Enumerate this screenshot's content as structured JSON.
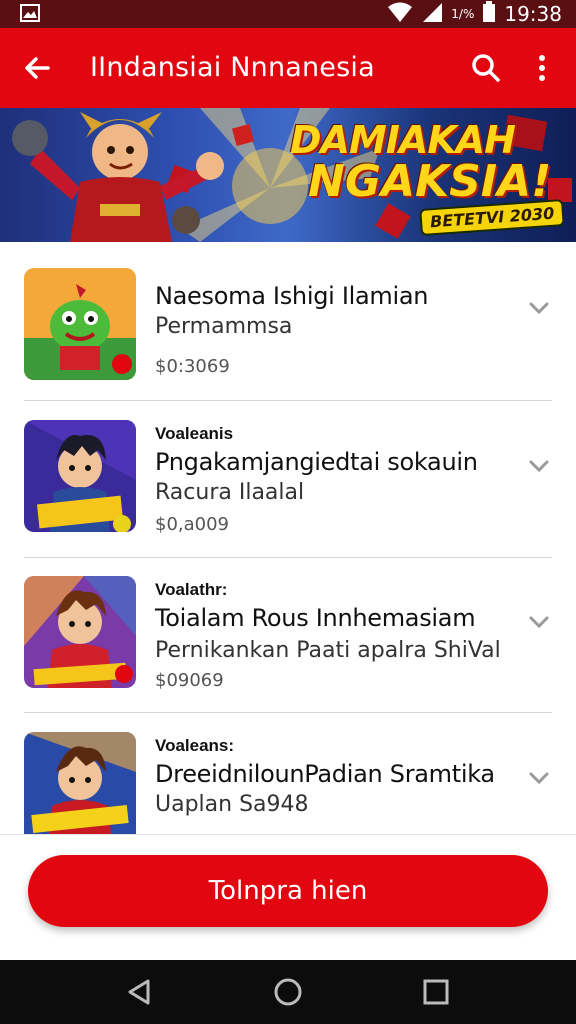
{
  "status_bar": {
    "time": "19:38",
    "battery_text": "1/%",
    "icons": [
      "image-icon",
      "wifi-icon",
      "signal-icon",
      "battery-icon"
    ]
  },
  "app_bar": {
    "title": "IIndansiai Nnnanesia",
    "icons": [
      "back-arrow-icon",
      "search-icon",
      "more-vert-icon"
    ],
    "color": "#e1060f"
  },
  "banner": {
    "title_line1": "DAMIAKAH",
    "title_line2": "NGAKSIA!",
    "tag": "BETETVI 2030"
  },
  "items": [
    {
      "kicker": "",
      "name": "Naesoma Ishigi Ilamian",
      "subtitle": "Permammsa",
      "price": "$0:3069"
    },
    {
      "kicker": "Voaleanis",
      "name": "Pngakamjangiedtai sokauin",
      "subtitle": "Racura Ilaalal",
      "price": "$0,a009"
    },
    {
      "kicker": "Voalathr:",
      "name": "Toialam Rous Innhemasiam",
      "subtitle": "Pernikankan Paati apalra ShiVal",
      "price": "$09069"
    },
    {
      "kicker": "Voaleans:",
      "name": "DreeidnilounPadian Sramtika",
      "subtitle": "Uaplan Sa948",
      "price": ""
    }
  ],
  "cta": {
    "label": "Tolnpra hien"
  },
  "nav": {
    "icons": [
      "back-triangle-icon",
      "home-circle-icon",
      "recents-square-icon"
    ]
  }
}
